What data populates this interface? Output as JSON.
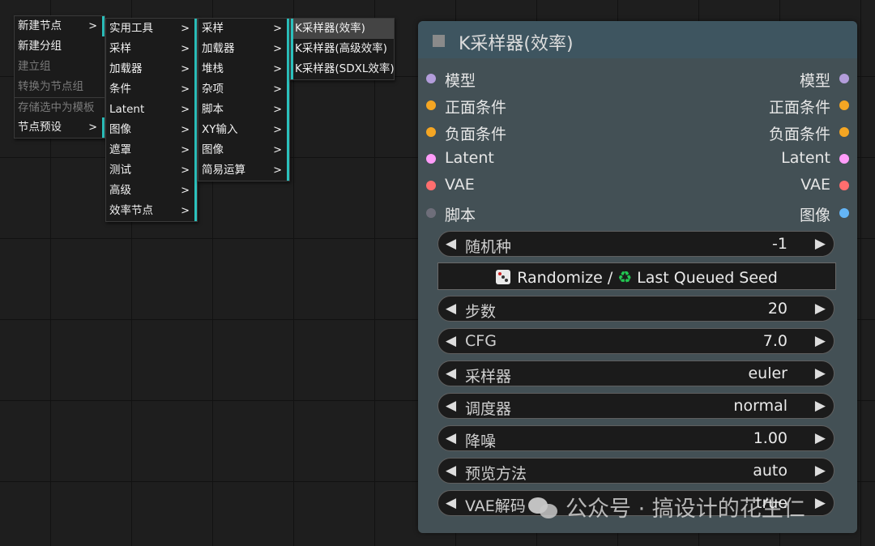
{
  "menu1": {
    "items": [
      {
        "label": "新建节点",
        "arrow": ">"
      },
      {
        "label": "新建分组"
      },
      {
        "label": "建立组"
      },
      {
        "label": "转换为节点组"
      },
      {
        "label": "存储选中为模板"
      },
      {
        "label": "节点预设",
        "arrow": ">"
      }
    ]
  },
  "menu2": {
    "items": [
      {
        "label": "实用工具",
        "arrow": ">"
      },
      {
        "label": "采样",
        "arrow": ">"
      },
      {
        "label": "加载器",
        "arrow": ">"
      },
      {
        "label": "条件",
        "arrow": ">"
      },
      {
        "label": "Latent",
        "arrow": ">"
      },
      {
        "label": "图像",
        "arrow": ">"
      },
      {
        "label": "遮罩",
        "arrow": ">"
      },
      {
        "label": "测试",
        "arrow": ">"
      },
      {
        "label": "高级",
        "arrow": ">"
      },
      {
        "label": "效率节点",
        "arrow": ">"
      }
    ]
  },
  "menu3": {
    "items": [
      {
        "label": "采样",
        "arrow": ">"
      },
      {
        "label": "加载器",
        "arrow": ">"
      },
      {
        "label": "堆栈",
        "arrow": ">"
      },
      {
        "label": "杂项",
        "arrow": ">"
      },
      {
        "label": "脚本",
        "arrow": ">"
      },
      {
        "label": "XY输入",
        "arrow": ">"
      },
      {
        "label": "图像",
        "arrow": ">"
      },
      {
        "label": "简易运算",
        "arrow": ">"
      }
    ]
  },
  "menu4": {
    "items": [
      {
        "label": "K采样器(效率)"
      },
      {
        "label": "K采样器(高级效率)"
      },
      {
        "label": "K采样器(SDXL效率)"
      }
    ]
  },
  "node": {
    "title": "K采样器(效率)",
    "io": [
      {
        "in": "模型",
        "in_color": "#b39ddb",
        "out": "模型",
        "out_color": "#b39ddb"
      },
      {
        "in": "正面条件",
        "in_color": "#f5a623",
        "out": "正面条件",
        "out_color": "#f5a623"
      },
      {
        "in": "负面条件",
        "in_color": "#f5a623",
        "out": "负面条件",
        "out_color": "#f5a623"
      },
      {
        "in": "Latent",
        "in_color": "#ff9cf9",
        "out": "Latent",
        "out_color": "#ff9cf9"
      },
      {
        "in": "VAE",
        "in_color": "#ff6e6e",
        "out": "VAE",
        "out_color": "#ff6e6e"
      },
      {
        "in": "脚本",
        "in_color": "#6e6e7a",
        "out": "图像",
        "out_color": "#64b5f6"
      }
    ],
    "seed": {
      "label": "随机种",
      "value": "-1"
    },
    "randomize_button": {
      "left": "Randomize /",
      "right": "Last Queued Seed"
    },
    "widgets": [
      {
        "label": "步数",
        "value": "20"
      },
      {
        "label": "CFG",
        "value": "7.0"
      },
      {
        "label": "采样器",
        "value": "euler"
      },
      {
        "label": "调度器",
        "value": "normal"
      },
      {
        "label": "降噪",
        "value": "1.00"
      },
      {
        "label": "预览方法",
        "value": "auto"
      },
      {
        "label": "VAE解码",
        "value": "true"
      }
    ]
  },
  "watermark": "公众号 · 搞设计的花生仁"
}
